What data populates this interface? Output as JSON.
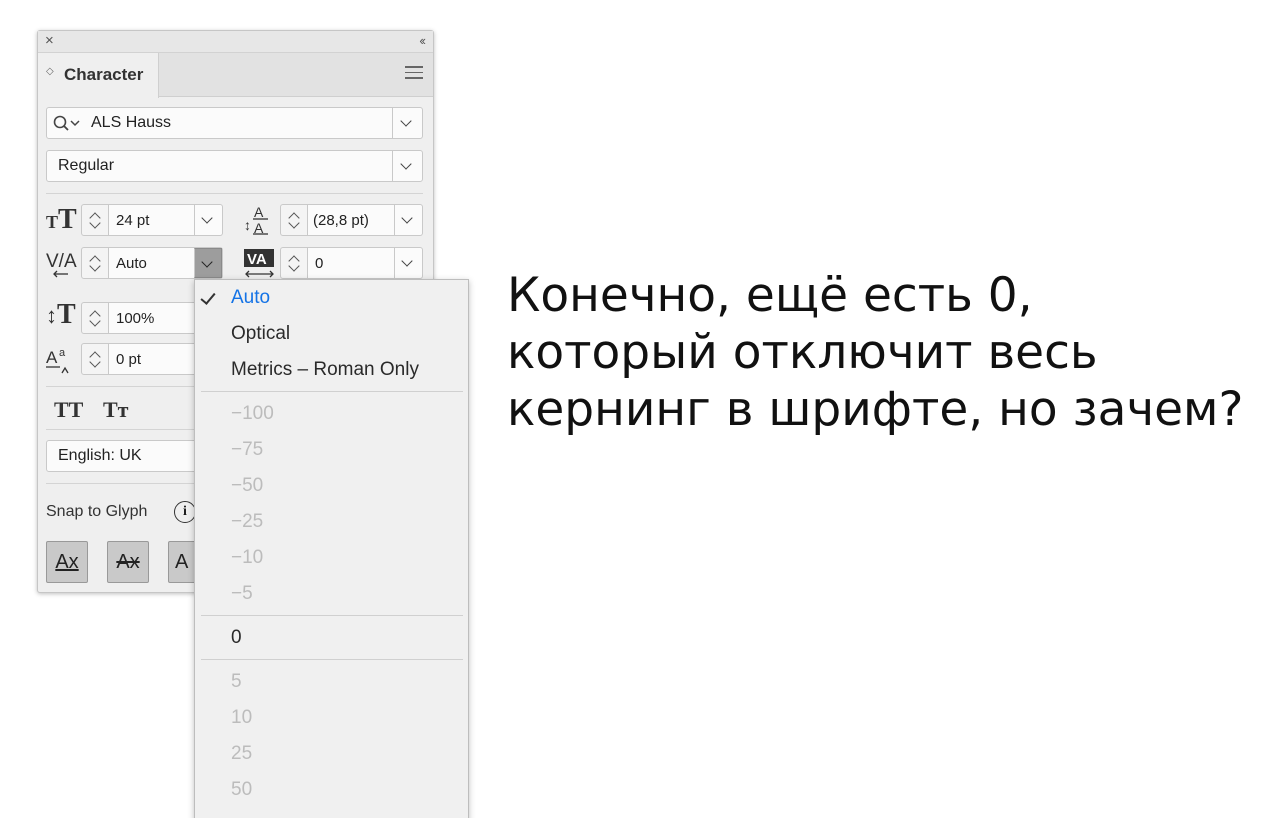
{
  "panel": {
    "close_glyph": "×",
    "collapse_glyph": "‹‹",
    "tab_label": "Character",
    "font_search_value": "ALS Hauss",
    "font_style_value": "Regular",
    "font_size_value": "24 pt",
    "leading_value": "(28,8 pt)",
    "kerning_value": "Auto",
    "tracking_value": "0",
    "vertical_scale_value": "100%",
    "baseline_shift_value": "0 pt",
    "all_caps_label": "TT",
    "small_caps_label": "Tт",
    "language_value": "English: UK",
    "snap_to_glyph_label": "Snap to Glyph",
    "info_glyph": "i",
    "glyph_buttons": [
      "Ax",
      "Ax",
      "A"
    ]
  },
  "kerning_menu": {
    "options": [
      {
        "label": "Auto",
        "state": "selected"
      },
      {
        "label": "Optical",
        "state": "enabled"
      },
      {
        "label": "Metrics – Roman Only",
        "state": "enabled"
      },
      {
        "label": "−100",
        "state": "disabled"
      },
      {
        "label": "−75",
        "state": "disabled"
      },
      {
        "label": "−50",
        "state": "disabled"
      },
      {
        "label": "−25",
        "state": "disabled"
      },
      {
        "label": "−10",
        "state": "disabled"
      },
      {
        "label": "−5",
        "state": "disabled"
      },
      {
        "label": "0",
        "state": "enabled"
      },
      {
        "label": "5",
        "state": "disabled"
      },
      {
        "label": "10",
        "state": "disabled"
      },
      {
        "label": "25",
        "state": "disabled"
      },
      {
        "label": "50",
        "state": "disabled"
      }
    ]
  },
  "caption": {
    "lines": [
      "Конечно, ещё есть 0,",
      "который отключит весь",
      "кернинг в шрифте, но зачем?"
    ]
  },
  "colors": {
    "selected_option": "#1473e6",
    "disabled_option": "#bcbcbc",
    "panel_bg": "#efefef"
  }
}
